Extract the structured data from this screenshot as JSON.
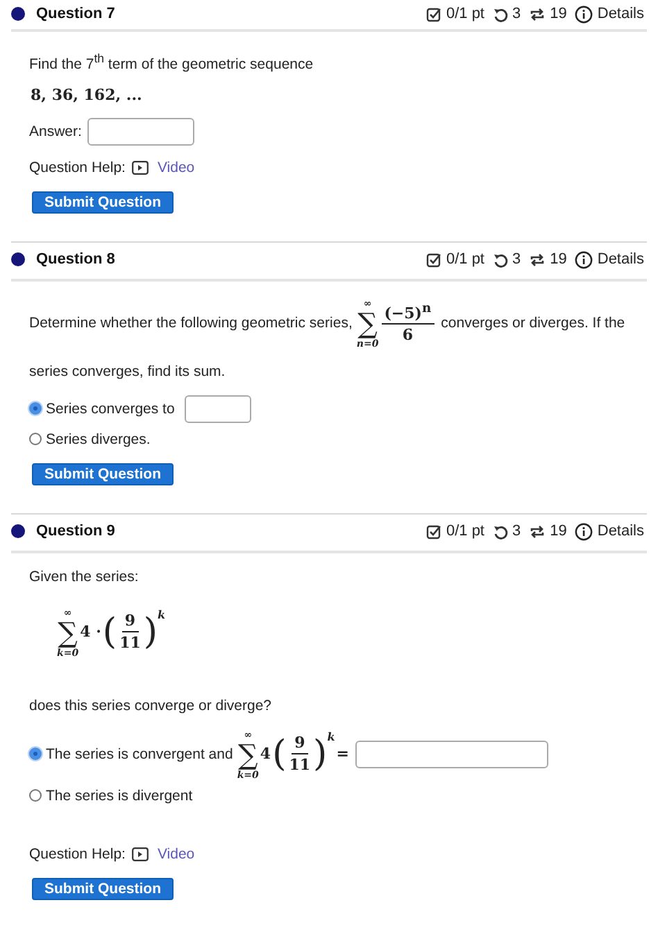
{
  "questions": [
    {
      "title": "Question 7",
      "score": "0/1 pt",
      "retries": "3",
      "attempts": "19",
      "details": "Details",
      "body": [
        {
          "kind": "text",
          "text": "Find the 7$^{th}$ term of the geometric sequence"
        },
        {
          "kind": "math",
          "tokens": [
            {
              "kind": "text",
              "text": "8, 36, 162, ..."
            }
          ]
        },
        {
          "kind": "answer",
          "label": "Answer:"
        },
        {
          "kind": "help",
          "label": "Question Help:",
          "link": "Video"
        }
      ],
      "submit": "Submit Question"
    },
    {
      "title": "Question 8",
      "score": "0/1 pt",
      "retries": "3",
      "attempts": "19",
      "details": "Details",
      "body": [
        {
          "kind": "mixed",
          "before": "Determine whether the following geometric series,",
          "tokens": [
            {
              "kind": "sum",
              "symbol": "∑",
              "upper": "∞",
              "lower": "n=0"
            },
            {
              "kind": "frac",
              "num": "(−5)$^{n}$",
              "den": "6"
            }
          ],
          "after": "converges or diverges. If the"
        },
        {
          "kind": "text",
          "text": "series converges, find its sum."
        },
        {
          "kind": "choices",
          "options": [
            {
              "label": "Series converges to",
              "selected": true,
              "has_input": true
            },
            {
              "label": "Series diverges.",
              "selected": false
            }
          ]
        }
      ],
      "submit": "Submit Question"
    },
    {
      "title": "Question 9",
      "score": "0/1 pt",
      "retries": "3",
      "attempts": "19",
      "details": "Details",
      "body": [
        {
          "kind": "text",
          "text": "Given the series:"
        },
        {
          "kind": "display",
          "tokens": [
            {
              "kind": "sum",
              "symbol": "∑",
              "upper": "∞",
              "lower": "k=0"
            },
            {
              "kind": "text",
              "text": "4 ·"
            },
            {
              "kind": "paren",
              "text": "("
            },
            {
              "kind": "frac",
              "num": "9",
              "den": "11"
            },
            {
              "kind": "paren",
              "text": ")"
            },
            {
              "kind": "sup",
              "text": "k"
            }
          ]
        },
        {
          "kind": "text",
          "text": "does this series converge or diverge?"
        },
        {
          "kind": "choices",
          "options": [
            {
              "label": "The series is convergent and",
              "selected": true,
              "tokens": [
                {
                  "kind": "sum",
                  "symbol": "∑",
                  "upper": "∞",
                  "lower": "k=0"
                },
                {
                  "kind": "text",
                  "text": "4"
                },
                {
                  "kind": "paren",
                  "text": "("
                },
                {
                  "kind": "frac",
                  "num": "9",
                  "den": "11"
                },
                {
                  "kind": "paren",
                  "text": ")"
                },
                {
                  "kind": "sup",
                  "text": "k"
                },
                {
                  "kind": "text",
                  "text": "="
                }
              ],
              "has_input": true
            },
            {
              "label": "The series is divergent",
              "selected": false
            }
          ]
        },
        {
          "kind": "help",
          "label": "Question Help:",
          "link": "Video"
        }
      ],
      "submit": "Submit Question"
    }
  ]
}
